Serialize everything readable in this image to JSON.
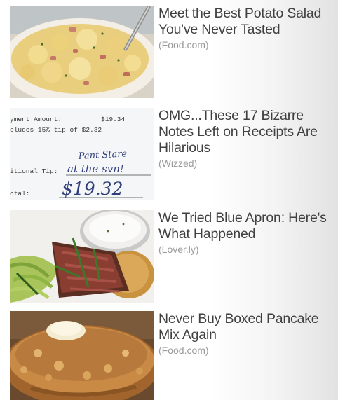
{
  "feed": {
    "items": [
      {
        "headline": "Meet the Best Potato Salad You've Never Tasted",
        "source": "(Food.com)",
        "image_subject": "potato-salad-photo"
      },
      {
        "headline": "OMG...These 17 Bizarre Notes Left on Receipts Are Hilarious",
        "source": "(Wizzed)",
        "image_subject": "receipt-photo",
        "image_text": {
          "line1_label": "yment Amount:",
          "line1_value": "$19.34",
          "line2": "cludes 15% tip of $2.32",
          "handwriting1": "Pant Stare",
          "tip_label": "itional Tip:",
          "handwriting2": "at the svn!",
          "total_label": "otal:",
          "total_value": "$19.32"
        }
      },
      {
        "headline": "We Tried Blue Apron: Here's What Happened",
        "source": "(Lover.ly)",
        "image_subject": "steak-dinner-photo"
      },
      {
        "headline": "Never Buy Boxed Pancake Mix Again",
        "source": "(Food.com)",
        "image_subject": "pancake-photo"
      }
    ]
  },
  "colors": {
    "headline": "#404040",
    "source": "#9a9a9a"
  }
}
